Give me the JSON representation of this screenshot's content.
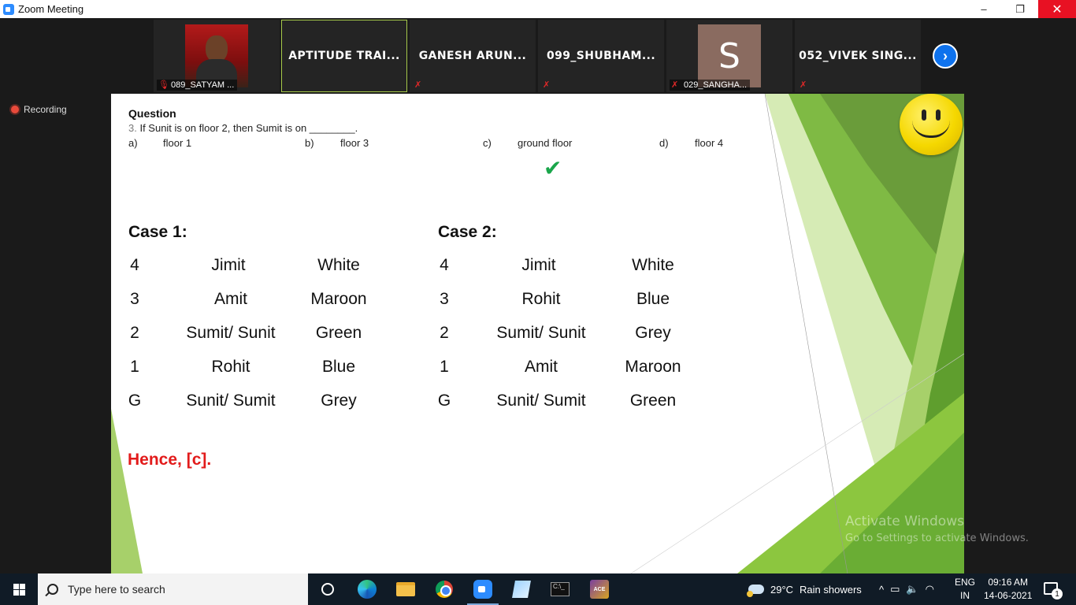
{
  "window": {
    "title": "Zoom Meeting",
    "minimize": "–",
    "maximize": "❐",
    "close": "✕"
  },
  "participants": [
    {
      "name": "089_SATYAM ...",
      "type": "photo"
    },
    {
      "name": "APTITUDE TRAI...",
      "type": "name-tile",
      "active_speaker": true
    },
    {
      "name": "GANESH ARUN...",
      "type": "name-tile"
    },
    {
      "name": "099_SHUBHAM...",
      "type": "name-tile"
    },
    {
      "name": "029_SANGHA...",
      "type": "avatar",
      "avatar_letter": "S"
    },
    {
      "name": "052_VIVEK SING...",
      "type": "name-tile"
    }
  ],
  "recording_label": "Recording",
  "slide": {
    "question_heading": "Question",
    "question_number": "3.",
    "question_text": " If Sunit is on floor 2, then Sumit is on ________.",
    "options": [
      {
        "letter": "a)",
        "text": "floor 1"
      },
      {
        "letter": "b)",
        "text": "floor 3"
      },
      {
        "letter": "c)",
        "text": "ground floor"
      },
      {
        "letter": "d)",
        "text": "floor 4"
      }
    ],
    "check_mark": "✔",
    "case1": {
      "heading": "Case 1:",
      "rows": [
        [
          "4",
          "Jimit",
          "White"
        ],
        [
          "3",
          "Amit",
          "Maroon"
        ],
        [
          "2",
          "Sumit/ Sunit",
          "Green"
        ],
        [
          "1",
          "Rohit",
          "Blue"
        ],
        [
          "G",
          "Sunit/ Sumit",
          "Grey"
        ]
      ]
    },
    "case2": {
      "heading": "Case 2:",
      "rows": [
        [
          "4",
          "Jimit",
          "White"
        ],
        [
          "3",
          "Rohit",
          "Blue"
        ],
        [
          "2",
          "Sumit/ Sunit",
          "Grey"
        ],
        [
          "1",
          "Amit",
          "Maroon"
        ],
        [
          "G",
          "Sunit/ Sumit",
          "Green"
        ]
      ]
    },
    "conclusion": "Hence, [c]."
  },
  "watermark": {
    "line1": "Activate Windows",
    "line2": "Go to Settings to activate Windows."
  },
  "taskbar": {
    "search_placeholder": "Type here to search",
    "weather_temp": "29°C",
    "weather_text": "Rain showers",
    "lang_top": "ENG",
    "lang_bottom": "IN",
    "time": "09:16 AM",
    "date": "14-06-2021",
    "notification_count": "1",
    "game_icon_text": "ACE"
  },
  "colors": {
    "accent_blue": "#0e72ed",
    "correct_green": "#1aa64b",
    "conclusion_red": "#e21b1b",
    "slide_green": "#8cc63f"
  }
}
